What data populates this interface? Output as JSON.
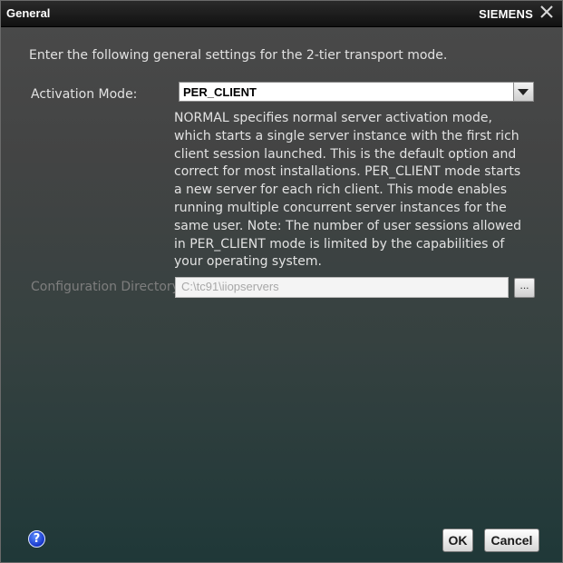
{
  "window": {
    "title": "General",
    "brand": "SIEMENS",
    "close_icon": "close-icon"
  },
  "intro_text": "Enter the following general settings for the 2-tier transport mode.",
  "activation_mode": {
    "label": "Activation Mode:",
    "selected_value": "PER_CLIENT",
    "dropdown_icon": "chevron-down-icon"
  },
  "description": "NORMAL specifies normal server activation mode, which starts a single server instance with the first rich client session launched. This is the default option and correct for most installations. PER_CLIENT mode starts a new server for each rich client. This mode enables running multiple concurrent server instances for the same user. Note: The number of user sessions allowed in PER_CLIENT mode is limited by the capabilities of your operating system.",
  "config_directory": {
    "label": "Configuration Directory:",
    "value": "C:\\tc91\\iiopservers",
    "browse_label": "..."
  },
  "buttons": {
    "help_label": "?",
    "ok_label": "OK",
    "cancel_label": "Cancel"
  },
  "colors": {
    "title_bar": "#151515",
    "background_top": "#4a4a4a",
    "background_bottom": "#1f3838",
    "help_icon": "#1736c8"
  }
}
